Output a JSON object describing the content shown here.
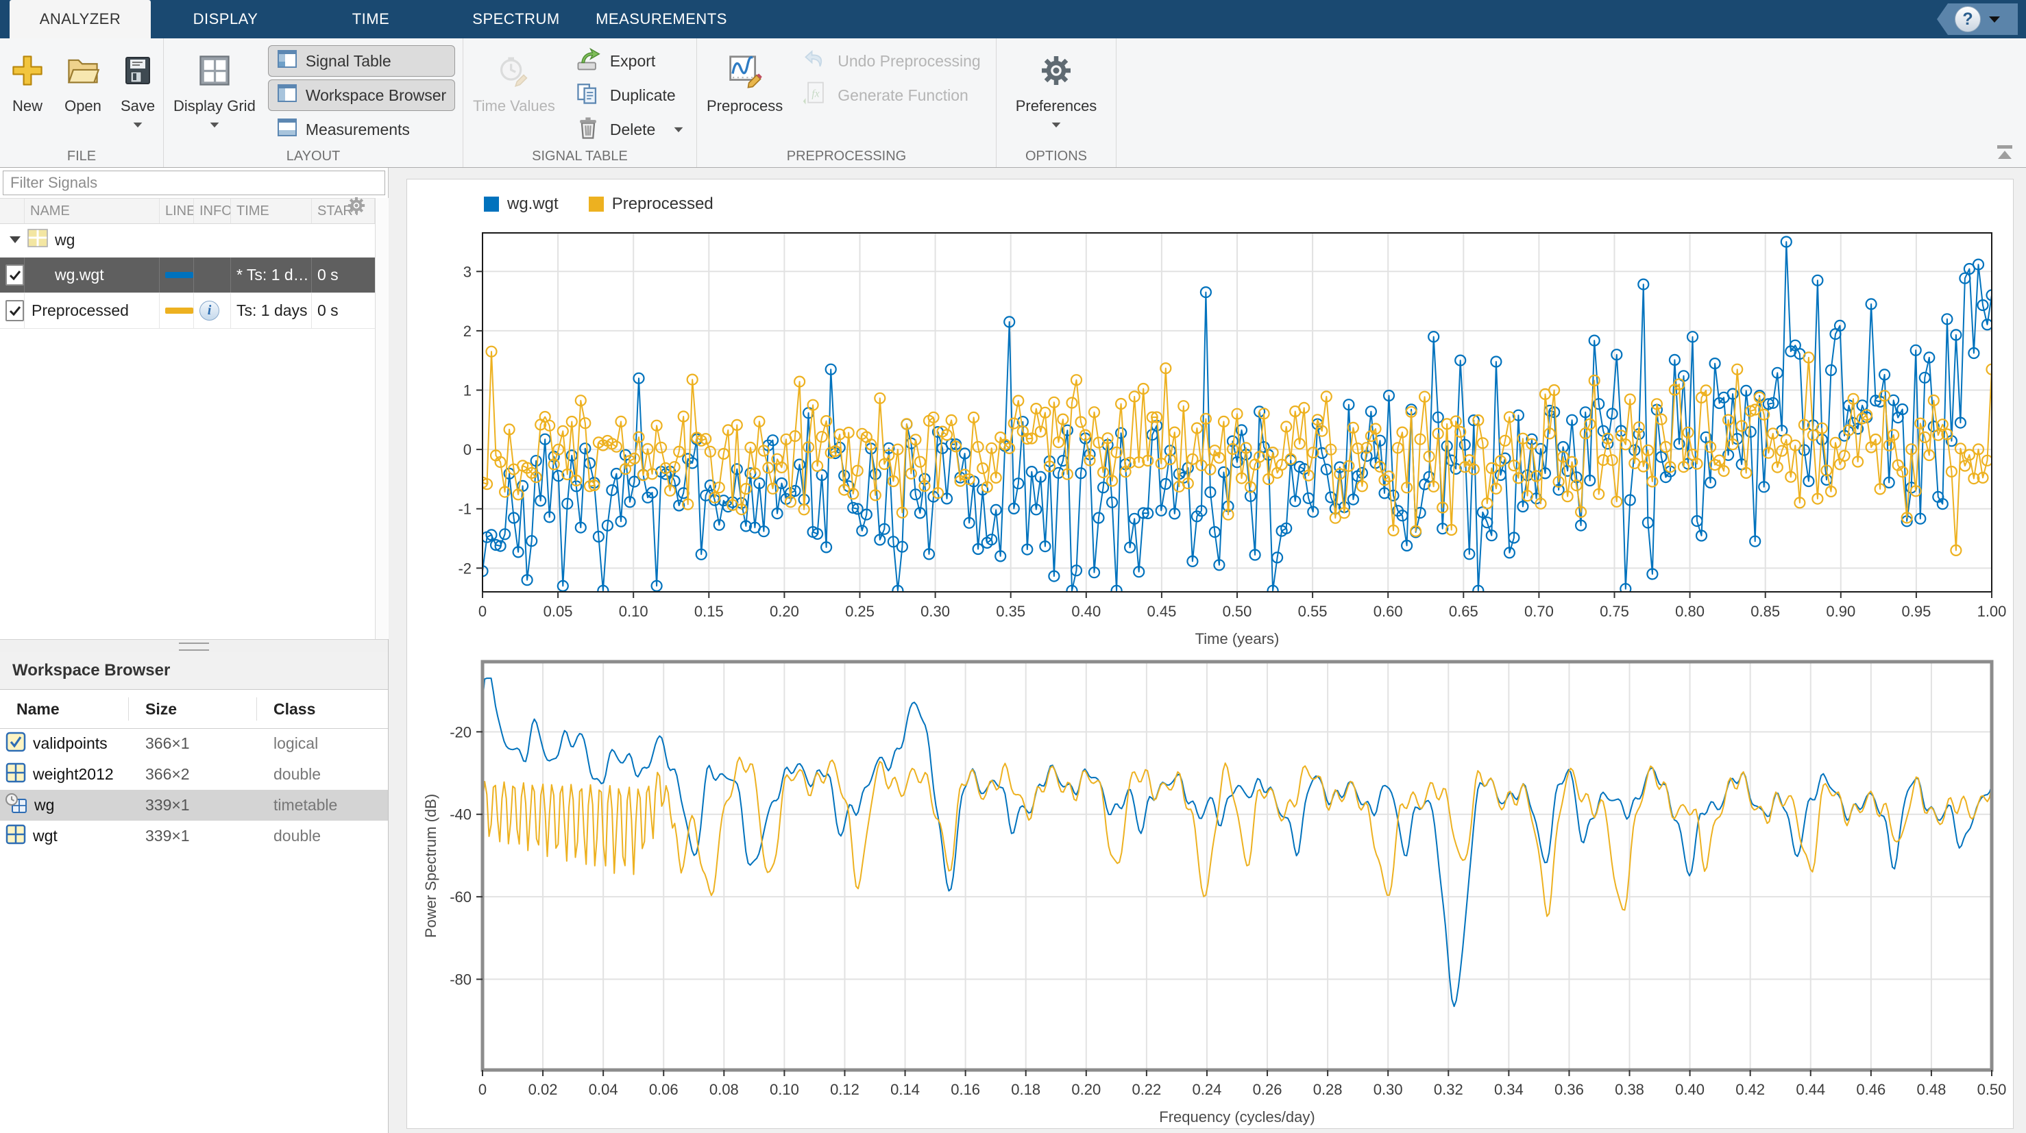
{
  "colors": {
    "blue": "#0072BD",
    "yellow": "#EDB120",
    "tabbar_bg": "#1A4971",
    "grid_line": "#E2E2E2",
    "time_box": "#1A1A1A",
    "spectrum_box": "#8C8C8C"
  },
  "tabbar": {
    "tabs": [
      {
        "label": "ANALYZER",
        "active": true
      },
      {
        "label": "DISPLAY",
        "active": false
      },
      {
        "label": "TIME",
        "active": false
      },
      {
        "label": "SPECTRUM",
        "active": false
      },
      {
        "label": "MEASUREMENTS",
        "active": false
      }
    ],
    "help_label": "?"
  },
  "ribbon": {
    "file": {
      "label": "FILE",
      "new": "New",
      "open": "Open",
      "save": "Save"
    },
    "layout": {
      "label": "LAYOUT",
      "display_grid": "Display Grid",
      "signal_table": "Signal Table",
      "workspace_browser": "Workspace Browser",
      "measurements": "Measurements",
      "signal_table_pressed": true,
      "workspace_browser_pressed": true,
      "measurements_pressed": false
    },
    "signal_table": {
      "label": "SIGNAL TABLE",
      "time_values": "Time Values",
      "export": "Export",
      "duplicate": "Duplicate",
      "delete": "Delete",
      "time_values_disabled": true
    },
    "preprocessing": {
      "label": "PREPROCESSING",
      "preprocess": "Preprocess",
      "undo": "Undo Preprocessing",
      "generate": "Generate Function",
      "undo_disabled": true,
      "generate_disabled": true
    },
    "options": {
      "label": "OPTIONS",
      "preferences": "Preferences"
    }
  },
  "signal_panel": {
    "filter_placeholder": "Filter Signals",
    "columns": [
      "NAME",
      "LINE",
      "INFO",
      "TIME",
      "START"
    ],
    "group_row": {
      "name": "wg",
      "expanded": true
    },
    "rows": [
      {
        "name": "wg.wgt",
        "checked": true,
        "selected": true,
        "line_color": "#0072BD",
        "info": null,
        "time": "* Ts: 1 d…",
        "start": "0 s",
        "indent": true
      },
      {
        "name": "Preprocessed",
        "checked": true,
        "selected": false,
        "line_color": "#EDB120",
        "info": "info-icon",
        "time": "Ts: 1 days",
        "start": "0 s",
        "indent": false
      }
    ]
  },
  "workspace_panel": {
    "title": "Workspace Browser",
    "columns": [
      "Name",
      "Size",
      "Class"
    ],
    "rows": [
      {
        "name": "validpoints",
        "size": "366×1",
        "class": "logical",
        "icon": "logical-checkbox-icon",
        "selected": false
      },
      {
        "name": "weight2012",
        "size": "366×2",
        "class": "double",
        "icon": "matrix-icon",
        "selected": false
      },
      {
        "name": "wg",
        "size": "339×1",
        "class": "timetable",
        "icon": "timetable-icon",
        "selected": true
      },
      {
        "name": "wgt",
        "size": "339×1",
        "class": "double",
        "icon": "matrix-icon",
        "selected": false
      }
    ]
  },
  "chart_data": [
    {
      "id": "time-display",
      "type": "line",
      "xlabel": "Time (years)",
      "ylabel": "",
      "xlim": [
        0,
        1
      ],
      "ylim": [
        -2.4,
        3.65
      ],
      "xtick_step": 0.05,
      "ytick_values": [
        -2,
        -1,
        0,
        1,
        2,
        3
      ],
      "grid": true,
      "legend": {
        "position": "top-left",
        "entries": [
          {
            "label": "wg.wgt",
            "color": "#0072BD"
          },
          {
            "label": "Preprocessed",
            "color": "#EDB120"
          }
        ]
      },
      "series": [
        {
          "name": "wg.wgt",
          "color": "#0072BD",
          "marker": "circle",
          "n": 339,
          "synthesis": {
            "seed": 7,
            "trend": [
              -1.45,
              2.1
            ],
            "wobble": [
              0.35,
              1.2,
              0.8
            ],
            "noise_amp": [
              0.62,
              0.9
            ],
            "outlier_prob": 0.025,
            "anchors": [
              [
                0,
                -2.05
              ],
              [
                0.03,
                -2.2
              ],
              [
                0.105,
                1.2
              ],
              [
                0.115,
                -2.3
              ],
              [
                0.23,
                1.35
              ],
              [
                0.35,
                2.15
              ],
              [
                0.48,
                2.65
              ],
              [
                0.63,
                1.9
              ],
              [
                0.757,
                -2.35
              ],
              [
                0.775,
                -2.1
              ],
              [
                0.865,
                3.5
              ],
              [
                0.885,
                2.85
              ],
              [
                0.92,
                2.45
              ],
              [
                0.96,
                1.55
              ],
              [
                1,
                2.6
              ]
            ],
            "clip": [
              -2.38,
              3.55
            ]
          }
        },
        {
          "name": "Preprocessed",
          "color": "#EDB120",
          "marker": "circle",
          "n": 339,
          "synthesis": {
            "seed": 13,
            "trend": [
              0.03,
              0
            ],
            "wobble": [
              0.12,
              2.3,
              2.0
            ],
            "noise_amp": [
              0.52,
              0.25
            ],
            "outlier_prob": 0.02,
            "anchors": [
              [
                0.007,
                1.65
              ],
              [
                0.04,
                0.55
              ],
              [
                0.5,
                0.6
              ],
              [
                0.83,
                1.35
              ],
              [
                0.88,
                1.55
              ],
              [
                0.975,
                -1.7
              ],
              [
                1,
                1.35
              ]
            ],
            "clip": [
              -1.75,
              1.7
            ]
          }
        }
      ]
    },
    {
      "id": "spectrum-display",
      "type": "line",
      "selected_display": true,
      "xlabel": "Frequency (cycles/day)",
      "ylabel": "Power Spectrum (dB)",
      "xlim": [
        0,
        0.5
      ],
      "ylim": [
        -102,
        -3
      ],
      "xtick_step": 0.02,
      "ytick_values": [
        -80,
        -60,
        -40,
        -20
      ],
      "grid": true,
      "series": [
        {
          "name": "wg.wgt",
          "color": "#0072BD",
          "n": 700,
          "synthesis": {
            "seed": 21,
            "base": [
              -31,
              -12
            ],
            "osc": [
              [
                3.2,
                70,
                0.5
              ],
              [
                2.6,
                36,
                1.7
              ],
              [
                1.8,
                192,
                0
              ]
            ],
            "start_boost": [
              16,
              0.045
            ],
            "peaks": [
              [
                0.143,
                16,
                0.0045
              ],
              [
                0.0035,
                6,
                0.003
              ]
            ],
            "dips": [
              [
                0.0705,
                18
              ],
              [
                0.089,
                27
              ],
              [
                0.118,
                14
              ],
              [
                0.155,
                23
              ],
              [
                0.175,
                12
              ],
              [
                0.218,
                14
              ],
              [
                0.245,
                13
              ],
              [
                0.2705,
                15
              ],
              [
                0.305,
                17
              ],
              [
                0.322,
                46
              ],
              [
                0.352,
                12
              ],
              [
                0.3645,
                11
              ],
              [
                0.4,
                17
              ],
              [
                0.435,
                12
              ],
              [
                0.468,
                14
              ],
              [
                0.49,
                11
              ]
            ],
            "dip_width": 0.0013,
            "clip_top": -7
          }
        },
        {
          "name": "Preprocessed",
          "color": "#EDB120",
          "n": 700,
          "synthesis": {
            "seed": 33,
            "base": [
              -31.5,
              -12
            ],
            "osc": [
              [
                3.2,
                70,
                0.5
              ],
              [
                2.6,
                36,
                1.7
              ],
              [
                1.8,
                192,
                0
              ]
            ],
            "comb": {
              "until": 0.055,
              "level": [
                -36.5,
                -60
              ],
              "amp": 4.5,
              "period": 0.00318,
              "deep": 5
            },
            "peaks": [],
            "dips": [
              [
                0.0655,
                14
              ],
              [
                0.075,
                29
              ],
              [
                0.095,
                17
              ],
              [
                0.125,
                18
              ],
              [
                0.155,
                16
              ],
              [
                0.21,
                14
              ],
              [
                0.24,
                21
              ],
              [
                0.253,
                16
              ],
              [
                0.3,
                27
              ],
              [
                0.325,
                14
              ],
              [
                0.353,
                23
              ],
              [
                0.377,
                25
              ],
              [
                0.405,
                14
              ],
              [
                0.44,
                17
              ],
              [
                0.47,
                12
              ]
            ],
            "dip_width": 0.0013,
            "clip_top": -19
          }
        }
      ]
    }
  ]
}
